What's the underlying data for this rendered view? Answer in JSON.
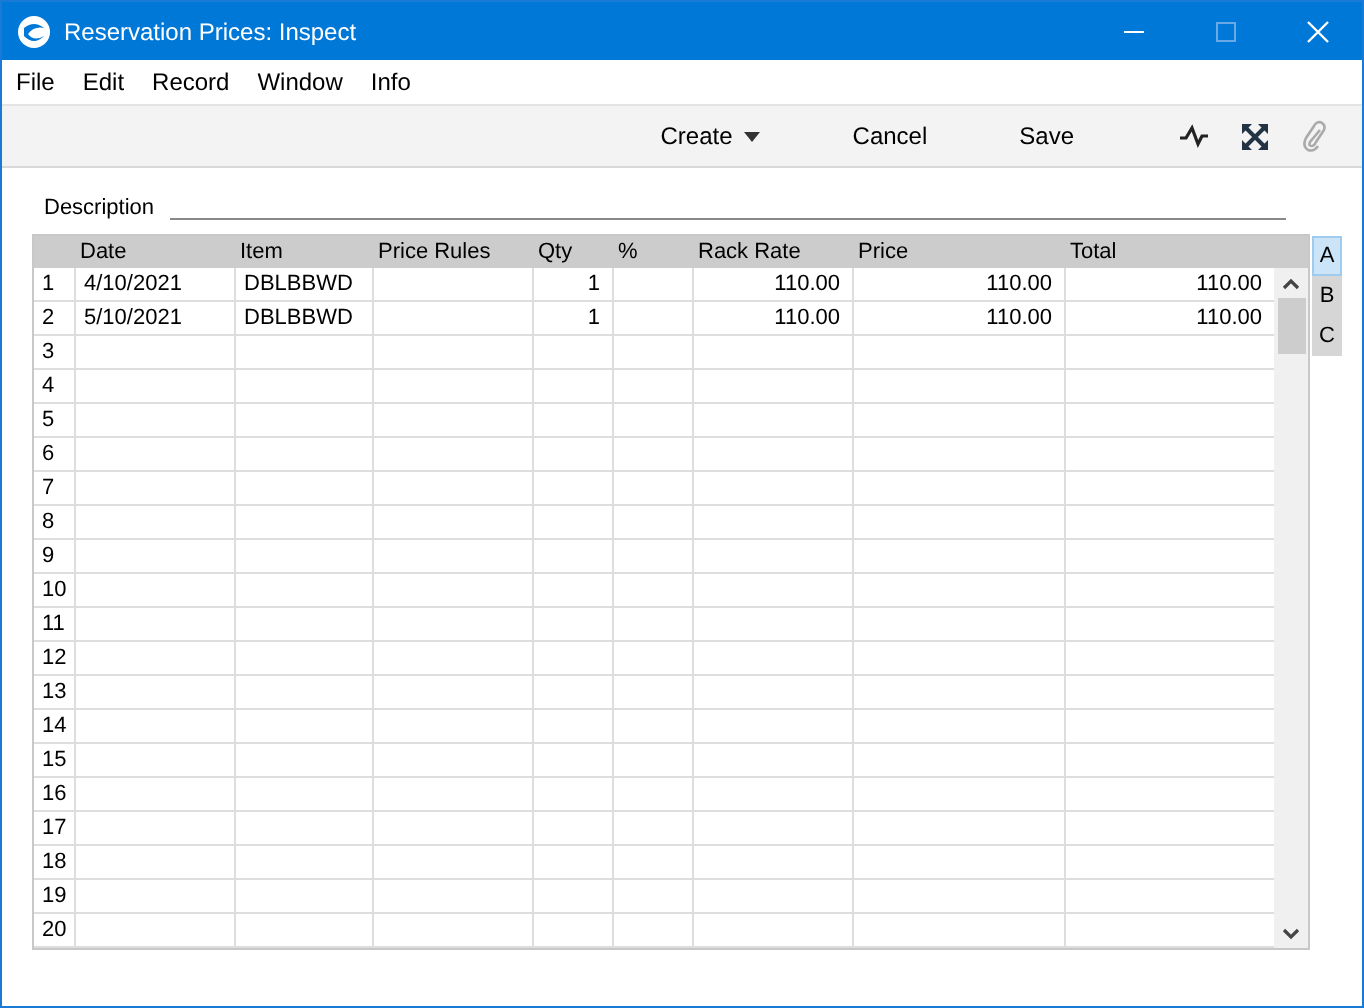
{
  "window": {
    "title": "Reservation Prices: Inspect"
  },
  "menu": [
    "File",
    "Edit",
    "Record",
    "Window",
    "Info"
  ],
  "toolbar": {
    "buttons": [
      {
        "label": "Create",
        "dropdown": true
      },
      {
        "label": "Cancel",
        "dropdown": false
      },
      {
        "label": "Save",
        "dropdown": false
      }
    ]
  },
  "description": {
    "label": "Description"
  },
  "table": {
    "columns": [
      "Date",
      "Item",
      "Price Rules",
      "Qty",
      "%",
      "Rack Rate",
      "Price",
      "Total"
    ],
    "rows": [
      {
        "number": "1",
        "cells": [
          "4/10/2021",
          "DBLBBWD",
          "",
          "1",
          "",
          "110.00",
          "110.00",
          "110.00"
        ]
      },
      {
        "number": "2",
        "cells": [
          "5/10/2021",
          "DBLBBWD",
          "",
          "1",
          "",
          "110.00",
          "110.00",
          "110.00"
        ]
      },
      {
        "number": "3"
      },
      {
        "number": "4"
      },
      {
        "number": "5"
      },
      {
        "number": "6"
      },
      {
        "number": "7"
      },
      {
        "number": "8"
      },
      {
        "number": "9"
      },
      {
        "number": "10"
      },
      {
        "number": "11"
      },
      {
        "number": "12"
      },
      {
        "number": "13"
      },
      {
        "number": "14"
      },
      {
        "number": "15"
      },
      {
        "number": "16"
      },
      {
        "number": "17"
      },
      {
        "number": "18"
      },
      {
        "number": "19"
      },
      {
        "number": "20"
      }
    ]
  },
  "side_tabs": [
    {
      "label": "A",
      "selected": true
    },
    {
      "label": "B",
      "selected": false
    },
    {
      "label": "C",
      "selected": false
    }
  ]
}
